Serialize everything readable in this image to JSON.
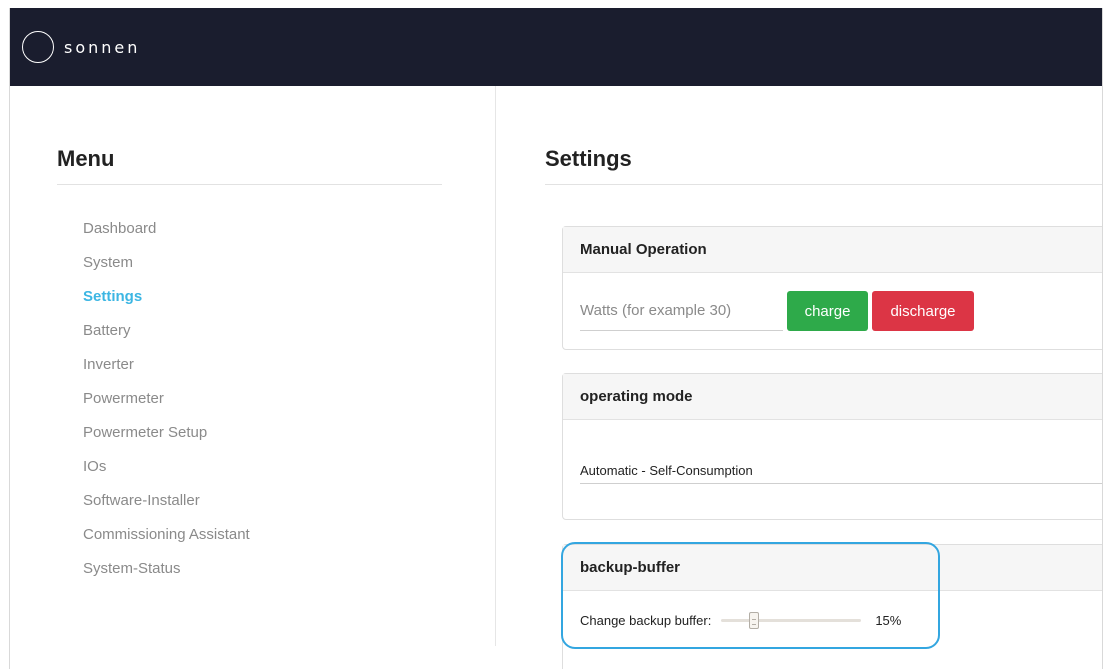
{
  "header": {
    "brand": "sonnen"
  },
  "sidebar": {
    "title": "Menu",
    "items": [
      {
        "label": "Dashboard",
        "active": false
      },
      {
        "label": "System",
        "active": false
      },
      {
        "label": "Settings",
        "active": true
      },
      {
        "label": "Battery",
        "active": false
      },
      {
        "label": "Inverter",
        "active": false
      },
      {
        "label": "Powermeter",
        "active": false
      },
      {
        "label": "Powermeter Setup",
        "active": false
      },
      {
        "label": "IOs",
        "active": false
      },
      {
        "label": "Software-Installer",
        "active": false
      },
      {
        "label": "Commissioning Assistant",
        "active": false
      },
      {
        "label": "System-Status",
        "active": false
      }
    ]
  },
  "main": {
    "title": "Settings",
    "manual_operation": {
      "title": "Manual Operation",
      "watts_value": "",
      "watts_placeholder": "Watts (for example 30)",
      "charge_label": "charge",
      "discharge_label": "discharge",
      "charge_color": "#2eaa4a",
      "discharge_color": "#dc3545"
    },
    "operating_mode": {
      "title": "operating mode",
      "selected": "Automatic - Self-Consumption"
    },
    "backup_buffer": {
      "title": "backup-buffer",
      "label": "Change backup buffer:",
      "value_percent": 15,
      "value_text": "15%"
    }
  },
  "colors": {
    "topbar": "#1a1d2e",
    "accent": "#3cb6e3",
    "highlight": "#33a6e0"
  }
}
